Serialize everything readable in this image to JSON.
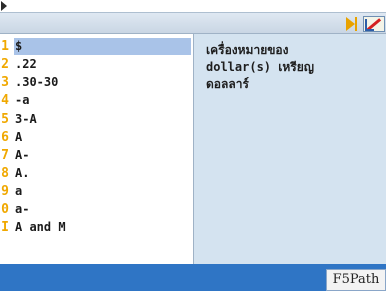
{
  "entries": [
    {
      "num": "1",
      "text": "$",
      "selected": true
    },
    {
      "num": "2",
      "text": ".22",
      "selected": false
    },
    {
      "num": "3",
      "text": ".30-30",
      "selected": false
    },
    {
      "num": "4",
      "text": "-a",
      "selected": false
    },
    {
      "num": "5",
      "text": "3-A",
      "selected": false
    },
    {
      "num": "6",
      "text": "A",
      "selected": false
    },
    {
      "num": "7",
      "text": "A-",
      "selected": false
    },
    {
      "num": "8",
      "text": "A.",
      "selected": false
    },
    {
      "num": "9",
      "text": "a",
      "selected": false
    },
    {
      "num": "0",
      "text": "a-",
      "selected": false
    },
    {
      "num": "I",
      "text": "A and M",
      "selected": false
    }
  ],
  "definition": "เครื่องหมายของ\ndollar(s) เหรียญ\nดอลลาร์",
  "footer": {
    "button_label": "F5Path"
  },
  "colors": {
    "accent": "#2f75c5",
    "selection": "#a9c3e8",
    "detail_bg": "#d4e3f0",
    "number": "#f0a800"
  }
}
